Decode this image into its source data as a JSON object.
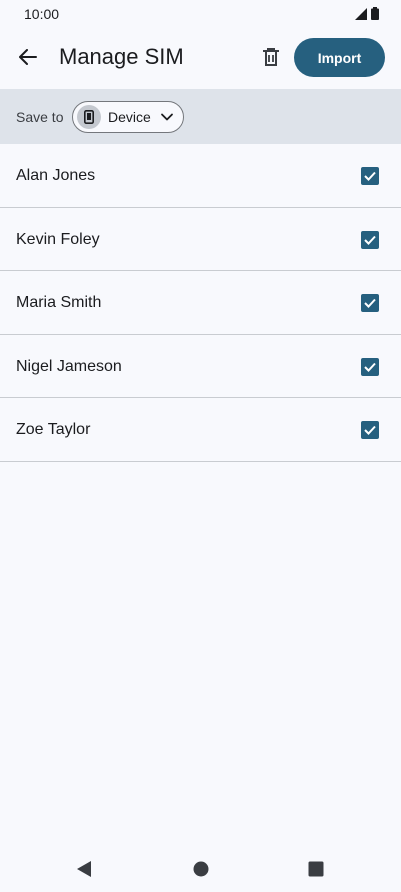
{
  "status_bar": {
    "time": "10:00"
  },
  "app_bar": {
    "title": "Manage SIM",
    "import_label": "Import"
  },
  "save_bar": {
    "label": "Save to",
    "selected_location": "Device"
  },
  "contacts": [
    {
      "name": "Alan Jones",
      "checked": true
    },
    {
      "name": "Kevin Foley",
      "checked": true
    },
    {
      "name": "Maria Smith",
      "checked": true
    },
    {
      "name": "Nigel Jameson",
      "checked": true
    },
    {
      "name": "Zoe Taylor",
      "checked": true
    }
  ],
  "colors": {
    "accent": "#26607f",
    "save_bar_bg": "#dee3ea",
    "page_bg": "#f8f9fd"
  }
}
